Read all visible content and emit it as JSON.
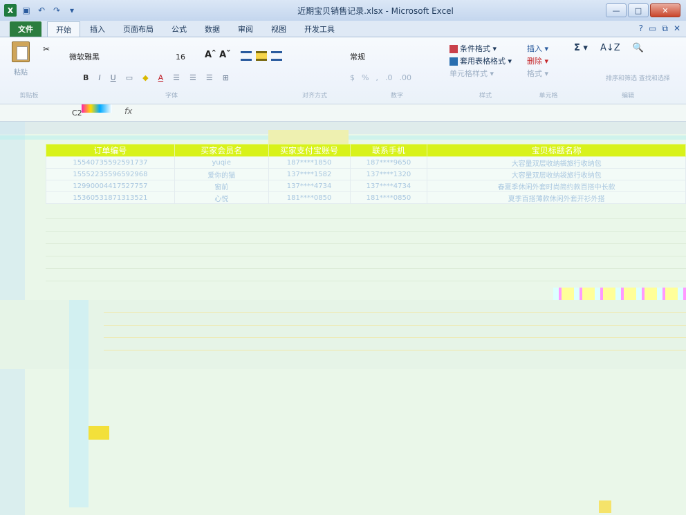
{
  "window": {
    "title": "近期宝贝销售记录.xlsx - Microsoft Excel",
    "logo": "X",
    "controls": {
      "minimize": "—",
      "maximize": "□",
      "close": "✕"
    }
  },
  "quick_access": {
    "save_icon": "save-icon",
    "undo_icon": "undo-icon",
    "redo_icon": "redo-icon",
    "customize": "▾"
  },
  "ribbon_tabs": [
    "文件",
    "开始",
    "插入",
    "页面布局",
    "公式",
    "数据",
    "审阅",
    "视图",
    "开发工具"
  ],
  "active_tab": "开始",
  "tabs_right": {
    "help": "?",
    "minimize": "▭",
    "restore": "⧉",
    "close": "✕"
  },
  "clipboard": {
    "paste_label": "粘贴",
    "group_label": "剪贴板"
  },
  "font": {
    "name": "微软雅黑",
    "size": "16",
    "grow": "Aˆ Aˇ",
    "bold": "B",
    "italic": "I",
    "underline": "U",
    "group_label": "字体"
  },
  "alignment": {
    "group_label": "对齐方式"
  },
  "number": {
    "format": "常规",
    "percent": "%",
    "comma": ",",
    "group_label": "数字"
  },
  "styles": {
    "conditional": "条件格式 ▾",
    "table": "套用表格格式 ▾",
    "cell": "单元格样式 ▾",
    "group_label": "样式"
  },
  "cells": {
    "insert": "插入 ▾",
    "delete": "删除 ▾",
    "format": "格式 ▾",
    "group_label": "单元格"
  },
  "editing": {
    "sum": "Σ ▾",
    "sort": "A↓Z",
    "find": "🔍",
    "sort_find_label": "排序和筛选 查找和选择",
    "group_label": "编辑"
  },
  "formula_bar": {
    "name_box": "C2",
    "fx": "fx"
  },
  "table": {
    "headers": [
      "订单编号",
      "买家会员名",
      "买家支付宝账号",
      "联系手机",
      "宝贝标题名称"
    ],
    "rows": [
      [
        "15540735592591737",
        "yuqie",
        "187****1850",
        "187****9650",
        "大容量双层收纳袋旅行收纳包"
      ],
      [
        "15552235596592968",
        "爱你的猫",
        "137****1582",
        "137****1320",
        "大容量双层收纳袋旅行收纳包"
      ],
      [
        "12990004417527757",
        "窗前",
        "137****4734",
        "137****4734",
        "春夏季休闲外套时尚简约款百搭中长款"
      ],
      [
        "15360531871313521",
        "心悦",
        "181****0850",
        "181****0850",
        "夏季百搭薄款休闲外套开衫外搭"
      ]
    ]
  }
}
